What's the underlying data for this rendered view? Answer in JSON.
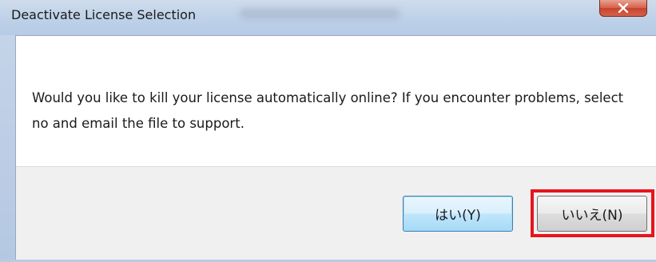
{
  "dialog": {
    "title": "Deactivate License Selection",
    "message": "Would you like to kill your license automatically online?  If you encounter problems, select no and email the file to support.",
    "buttons": {
      "yes_label": "はい(Y)",
      "no_label": "いいえ(N)"
    }
  },
  "icons": {
    "close": "close-icon"
  },
  "colors": {
    "highlight": "#e8141c",
    "close_button": "#c9432c",
    "default_button_border": "#3c7fb1"
  }
}
